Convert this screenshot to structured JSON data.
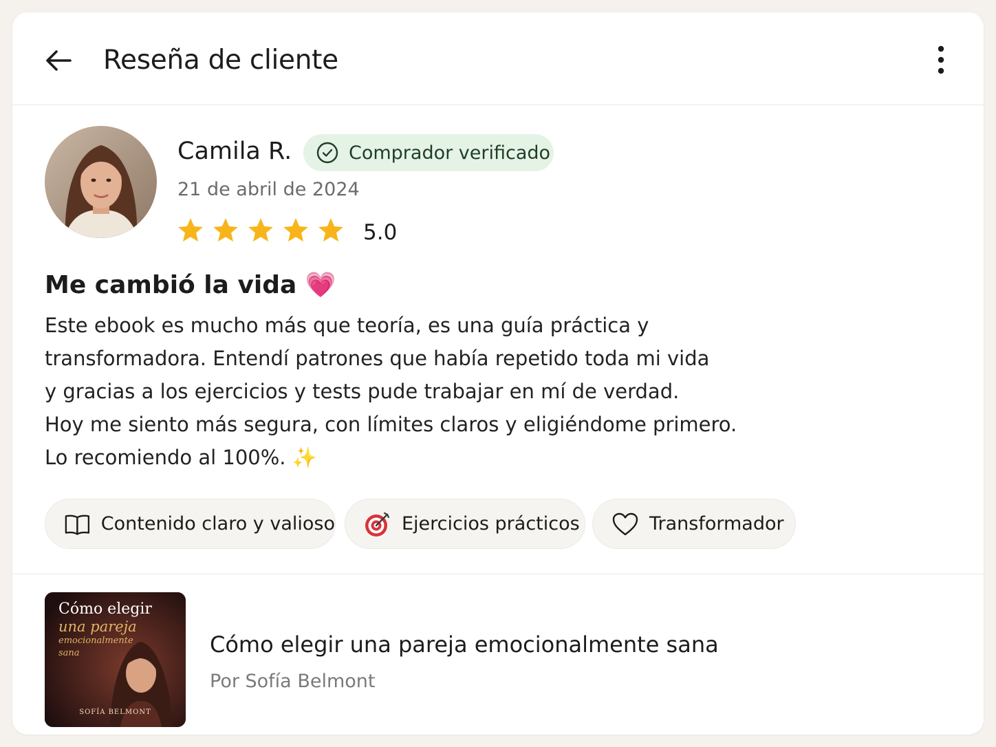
{
  "header": {
    "title": "Reseña de cliente",
    "back_icon": "arrow-left-icon",
    "more_icon": "more-vertical-icon"
  },
  "reviewer": {
    "name": "Camila R.",
    "badge": "Comprador verificado",
    "badge_icon": "check-circle-icon",
    "date": "21 de abril de 2024",
    "rating": 5,
    "rating_label": "5.0"
  },
  "review": {
    "title": "Me cambió la vida 💗",
    "lines": [
      "Este ebook es mucho más que teoría, es una guía práctica y",
      "transformadora. Entendí patrones que había repetido toda mi vida",
      "y gracias a los ejercicios y tests pude trabajar en mí de verdad.",
      "Hoy me siento más segura, con límites claros y eligiéndome primero.",
      "Lo recomiendo al 100%. ✨"
    ]
  },
  "tags": [
    {
      "label": "Contenido claro y valioso",
      "icon": "book-icon"
    },
    {
      "label": "Ejercicios prácticos",
      "icon": "target-icon"
    },
    {
      "label": "Transformador",
      "icon": "heart-icon"
    }
  ],
  "product": {
    "title": "Cómo elegir una pareja emocionalmente sana",
    "author": "Por Sofía Belmont",
    "cover": {
      "line1": "Cómo elegir",
      "line2": "una pareja",
      "line3": "emocionalmente",
      "line4": "sana",
      "author": "SOFÍA BELMONT"
    }
  },
  "colors": {
    "star": "#f7b51b",
    "badge_bg": "#e5f3e6",
    "badge_text": "#1f3d27",
    "cover_accent": "#e3b466"
  }
}
